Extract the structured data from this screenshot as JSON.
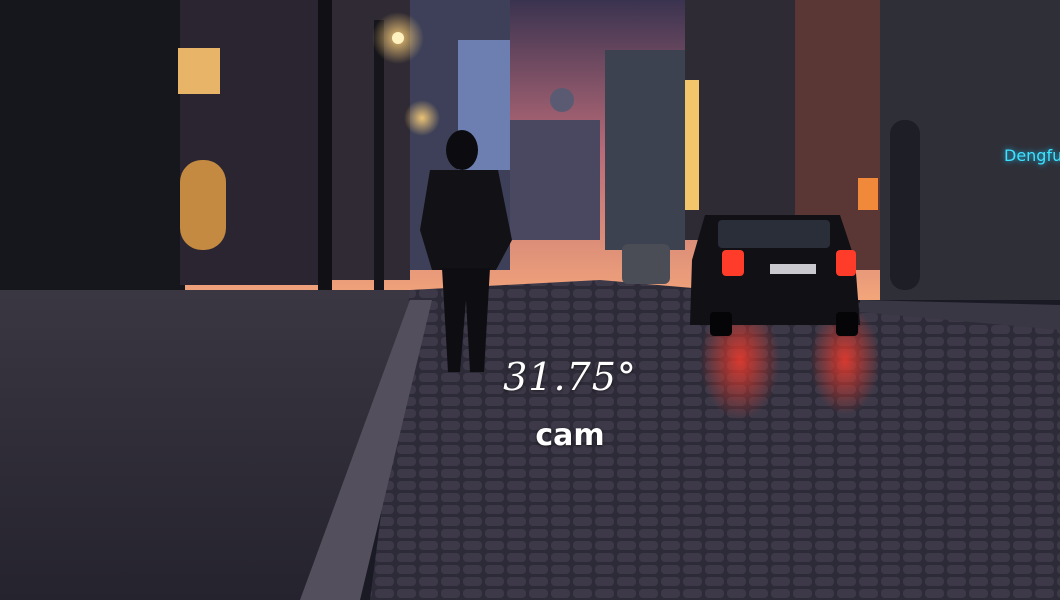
{
  "overlay": {
    "temperature": "31.75°",
    "label": "cam"
  },
  "sign": {
    "text": "Dengfu"
  },
  "palette": {
    "sky_top": "#3a3350",
    "sky_glow": "#f3a57a",
    "street": "#2c2a36",
    "lamp": "#ffcc66",
    "taillight": "#ff3b2a",
    "neon": "#3ee3ff"
  }
}
